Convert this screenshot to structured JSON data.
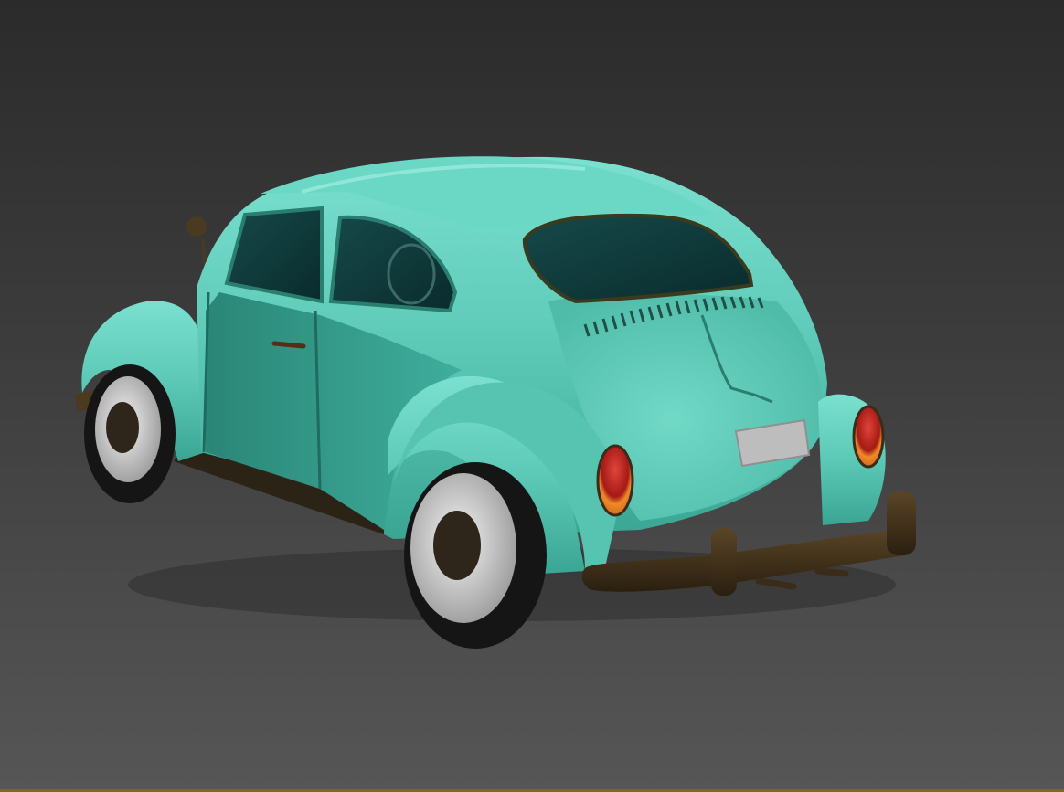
{
  "scene": {
    "subject_icon": "car-icon",
    "colors": {
      "background_top": "#2b2b2b",
      "background_bottom": "#565656",
      "body": "#5cc9b6",
      "body_shade": "#2e8f80",
      "body_highlight": "#8ee6d6",
      "window": "#0f3a3a",
      "bumper": "#3a2c18",
      "tire": "#151515",
      "rim": "#dadada",
      "hub": "#2e261a",
      "taillight_red": "#c0241c",
      "taillight_amber": "#ef8a2a",
      "plate": "#bdbdbd",
      "viewport_border": "#7a6a2a"
    }
  }
}
